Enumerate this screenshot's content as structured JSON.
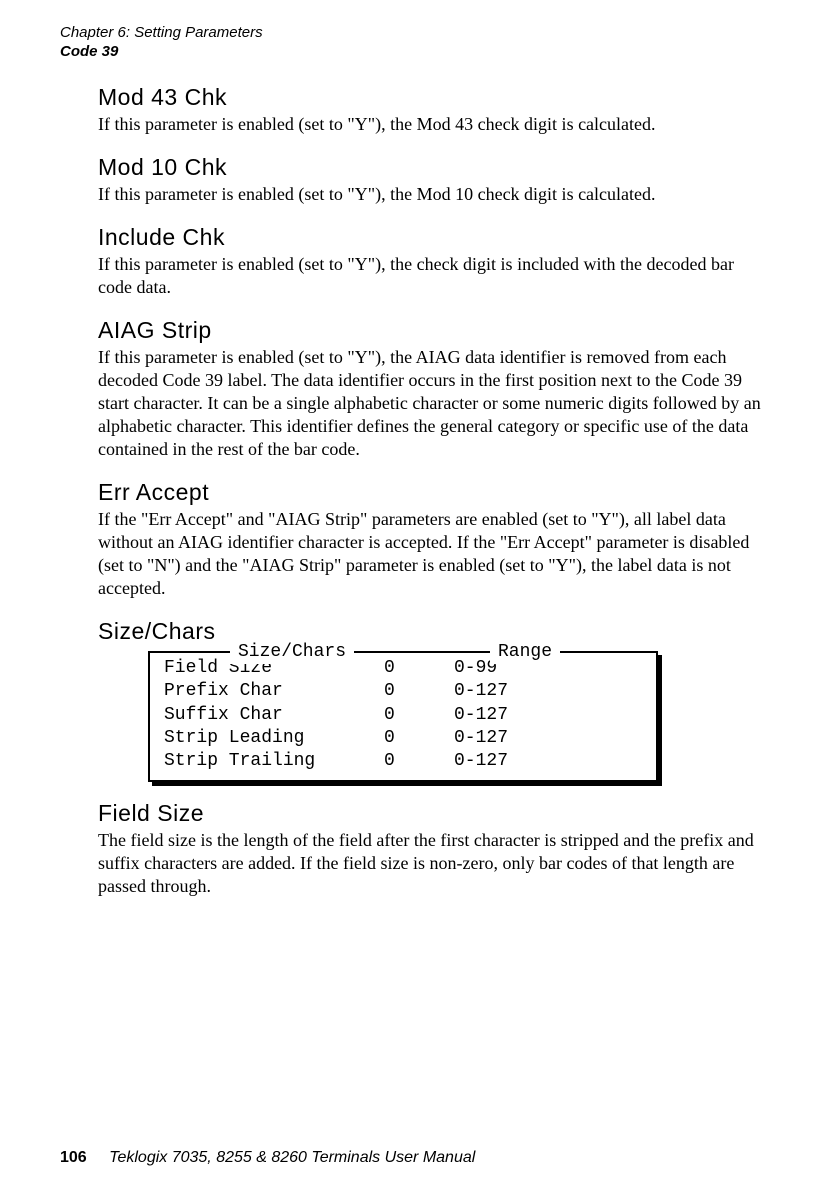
{
  "header": {
    "chapter": "Chapter 6: Setting Parameters",
    "section": "Code 39"
  },
  "sections": {
    "mod43": {
      "title": "Mod 43 Chk",
      "body": "If this parameter is enabled (set to \"Y\"), the Mod 43 check digit is calculated."
    },
    "mod10": {
      "title": "Mod 10 Chk",
      "body": "If this parameter is enabled (set to \"Y\"), the Mod 10 check digit is calculated."
    },
    "includechk": {
      "title": "Include Chk",
      "body": "If this parameter is enabled (set to \"Y\"), the check digit is included with the decoded bar code data."
    },
    "aiag": {
      "title": "AIAG Strip",
      "body": "If this parameter is enabled (set to \"Y\"), the AIAG data identifier is removed from each decoded Code 39 label. The data identifier occurs in the first position next to the Code 39 start character. It can be a single alphabetic character or some numeric digits followed by an alphabetic character. This identifier defines the general category or specific use of the data contained in the rest of the bar code."
    },
    "erraccept": {
      "title": "Err Accept",
      "body": "If the \"Err Accept\" and \"AIAG Strip\" parameters are enabled (set to \"Y\"), all label data without an AIAG identifier character is accepted. If the \"Err Accept\" parameter is disabled (set to \"N\") and the \"AIAG Strip\" parameter is enabled (set to \"Y\"), the label data is not accepted."
    },
    "sizechars": {
      "title": "Size/Chars",
      "table": {
        "legend_left": "Size/Chars",
        "legend_right": "Range",
        "rows": [
          {
            "label": "Field Size",
            "value": "0",
            "range": "0-99"
          },
          {
            "label": "Prefix Char",
            "value": "0",
            "range": "0-127"
          },
          {
            "label": "Suffix Char",
            "value": "0",
            "range": "0-127"
          },
          {
            "label": "Strip Leading",
            "value": "0",
            "range": "0-127"
          },
          {
            "label": "Strip Trailing",
            "value": "0",
            "range": "0-127"
          }
        ]
      }
    },
    "fieldsize": {
      "title": "Field Size",
      "body": "The field size is the length of the field after the first character is stripped and the prefix and suffix characters are added. If the field size is non-zero, only bar codes of that length are passed through."
    }
  },
  "footer": {
    "page_number": "106",
    "manual": "Teklogix 7035, 8255 & 8260 Terminals User Manual"
  }
}
